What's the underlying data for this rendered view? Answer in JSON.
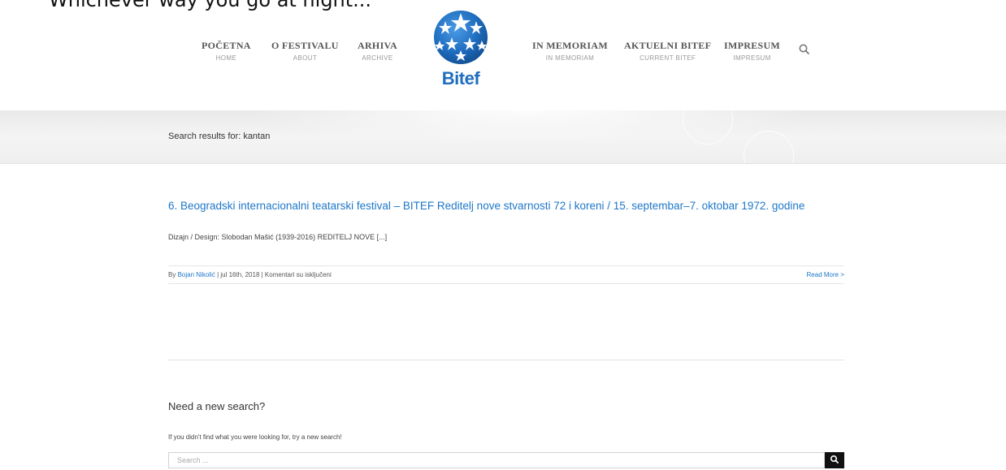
{
  "top_cut_text": "Whichever way you go at night...",
  "nav": {
    "left": [
      {
        "main": "POČETNA",
        "sub": "HOME"
      },
      {
        "main": "O FESTIVALU",
        "sub": "ABOUT"
      },
      {
        "main": "ARHIVA",
        "sub": "ARCHIVE"
      }
    ],
    "right": [
      {
        "main": "IN MEMORIAM",
        "sub": "IN MEMORIAM"
      },
      {
        "main": "AKTUELNI BITEF",
        "sub": "CURRENT BITEF"
      },
      {
        "main": "IMPRESUM",
        "sub": "IMPRESUM"
      }
    ]
  },
  "logo": {
    "text": "Bitef",
    "color": "#1f6dbf"
  },
  "page_title": "Search results for: kantan",
  "post": {
    "title": "6. Beogradski internacionalni teatarski festival – BITEF Reditelj nove stvarnosti 72 i koreni / 15. septembar–7. oktobar 1972. godine",
    "excerpt": "Dizajn / Design: Slobodan Mašić (1939-2016) REDITELJ NOVE [...]",
    "meta_by": "By",
    "meta_author": "Bojan Nikolić",
    "meta_rest": "| jul 16th, 2018 | Komentari su isključeni",
    "read_more": "Read More >"
  },
  "new_search": {
    "heading": "Need a new search?",
    "text": "If you didn't find what you were looking for, try a new search!",
    "placeholder": "Search ..."
  },
  "colors": {
    "link": "#1e77c9",
    "title_bar": "#efefef",
    "submit": "#111111"
  }
}
